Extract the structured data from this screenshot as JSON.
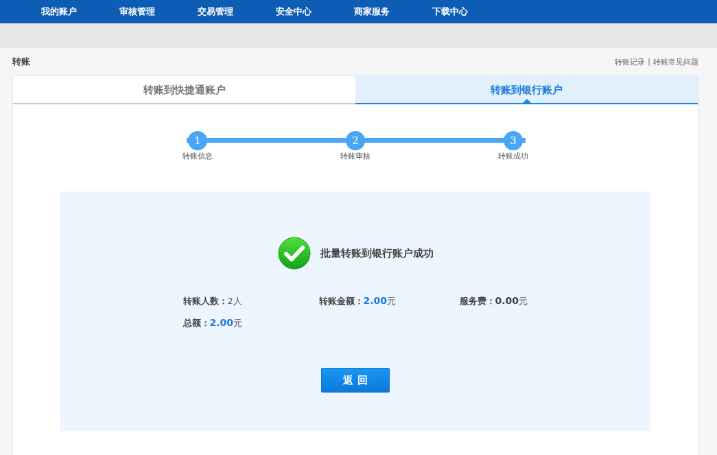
{
  "nav": [
    {
      "label": "我的账户",
      "selected": false
    },
    {
      "label": "审核管理",
      "selected": false
    },
    {
      "label": "交易管理",
      "selected": false
    },
    {
      "label": "安全中心",
      "selected": false
    },
    {
      "label": "商家服务",
      "selected": false
    },
    {
      "label": "下载中心",
      "selected": false
    }
  ],
  "page_title": "转账",
  "links": [
    "转账记录",
    "转账常见问题"
  ],
  "link_separator": "|",
  "tabs": [
    {
      "label": "转账到快捷通账户",
      "selected": false
    },
    {
      "label": "转账到银行账户",
      "selected": true
    }
  ],
  "steps": [
    {
      "number": "1",
      "label": "转账信息",
      "done": true
    },
    {
      "number": "2",
      "label": "转账审核",
      "done": true
    },
    {
      "number": "3",
      "label": "转账成功",
      "done": true
    }
  ],
  "result": {
    "message": "批量转账到银行账户成功",
    "items": [
      {
        "label": "转账人数：",
        "value": "2人",
        "kind": "plain"
      },
      {
        "label": "转账金额：",
        "value": "2.00",
        "unit": "元",
        "kind": "highlight"
      },
      {
        "label": "服务费：",
        "value": "0.00",
        "unit": "元",
        "kind": "strong"
      },
      {
        "label": "总额：",
        "value": "2.00",
        "unit": "元",
        "kind": "highlight"
      }
    ],
    "button": "返 回"
  }
}
